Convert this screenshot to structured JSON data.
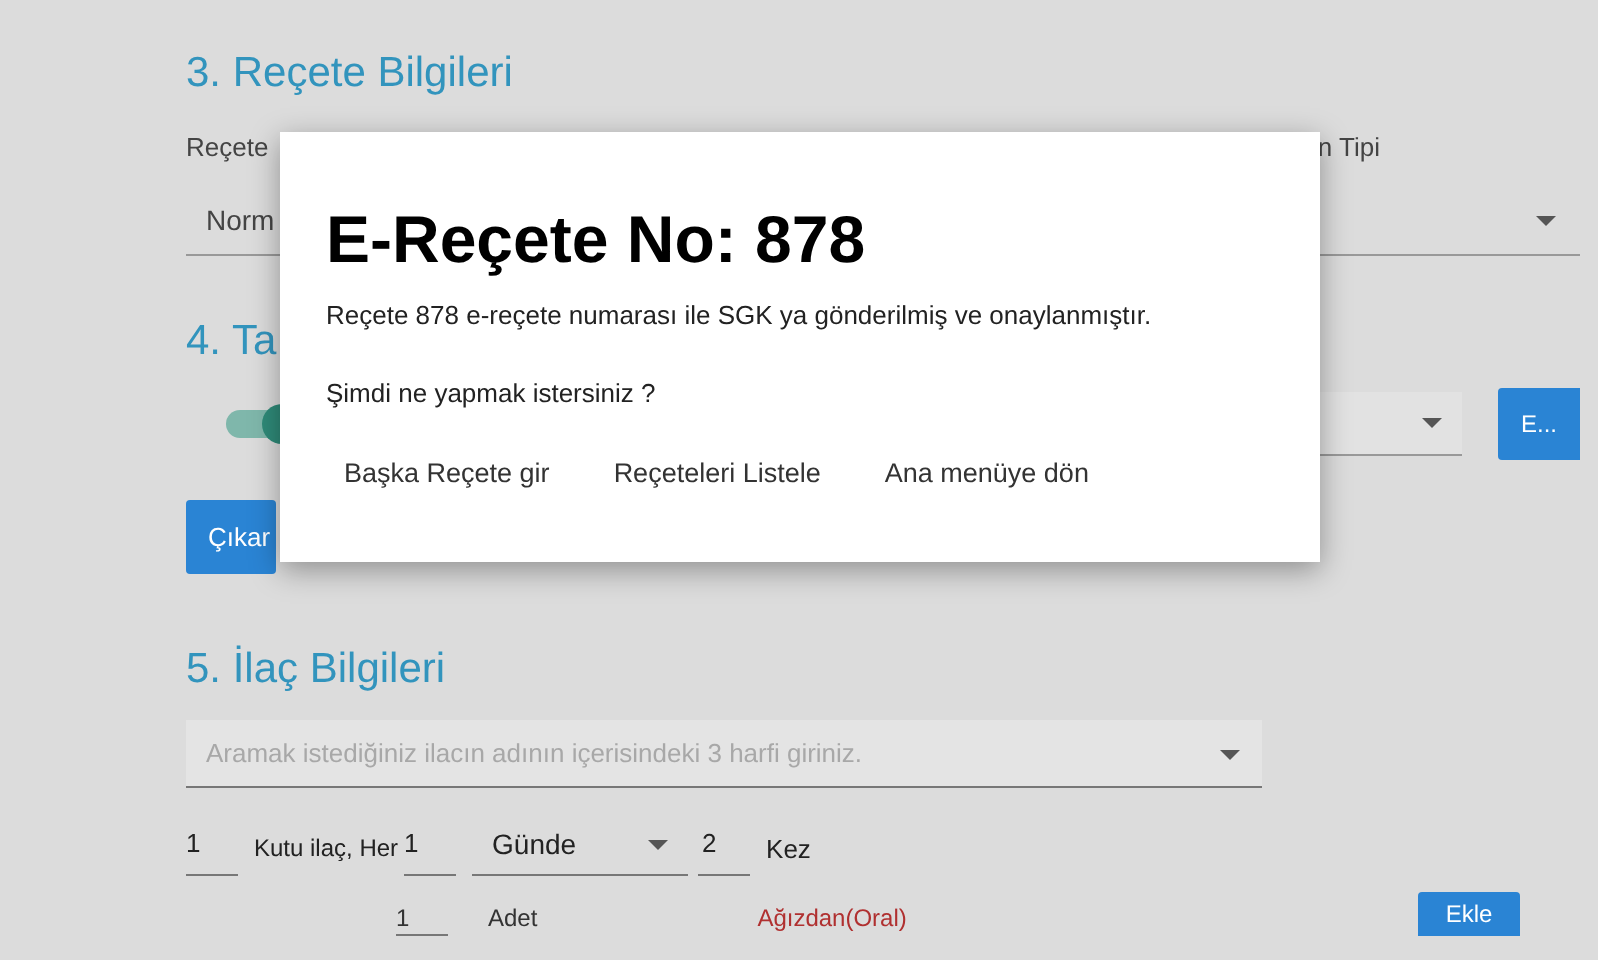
{
  "section_3": {
    "title": "3. Reçete Bilgileri",
    "labels": [
      "Reçete",
      "n Tipi"
    ],
    "type_select": {
      "value": "Norm"
    }
  },
  "section_4": {
    "title": "4. Ta",
    "toggle": {
      "on": true
    },
    "button_e": "E...",
    "remove_button": "Çıkar"
  },
  "section_5": {
    "title": "5. İlaç Bilgileri",
    "search": {
      "placeholder": "Aramak istediğiniz ilacın adının içerisindeki 3 harfi giriniz."
    },
    "dose_row": {
      "boxes": "1",
      "boxes_label": "Kutu ilaç, Her",
      "period": "1",
      "unit": "Günde",
      "times": "2",
      "times_label": "Kez"
    },
    "usage_row": {
      "amount": "1",
      "amount_unit": "Adet",
      "route": "Ağızdan(Oral)",
      "add_button": "Ekle"
    }
  },
  "dialog": {
    "title": "E-Reçete No: 878",
    "message": "Reçete 878 e-reçete numarası ile SGK ya gönderilmiş ve onaylanmıştır.",
    "question": "Şimdi ne yapmak istersiniz ?",
    "actions": [
      "Başka Reçete gir",
      "Reçeteleri Listele",
      "Ana menüye dön"
    ]
  }
}
